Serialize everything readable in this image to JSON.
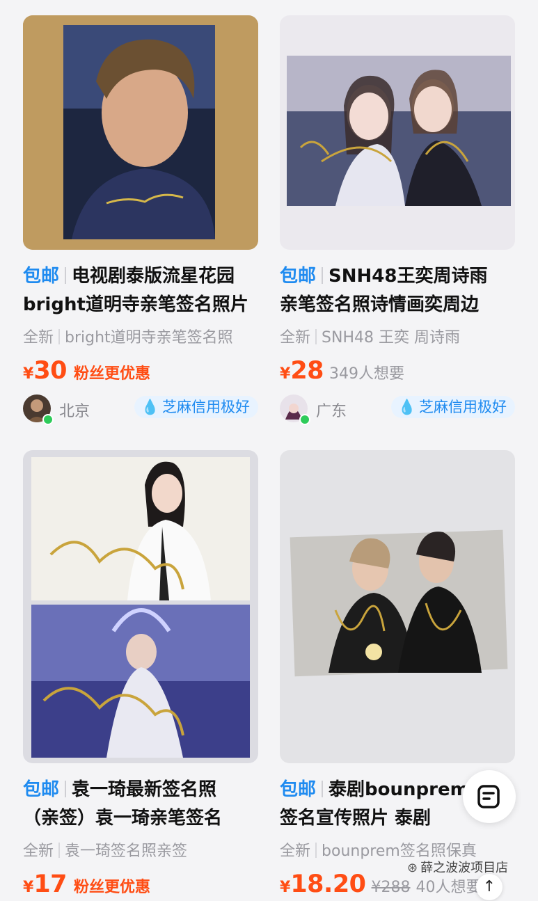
{
  "items": [
    {
      "tag": "包邮",
      "title_line1": "电视剧泰版流星花园",
      "title_line2": "bright道明寺亲笔签名照片",
      "condition": "全新",
      "keywords": "bright道明寺亲笔签名照",
      "currency": "¥",
      "price": "30",
      "promo": "粉丝更优惠",
      "wants": "",
      "original_price": "",
      "city": "北京",
      "credit": "芝麻信用极好"
    },
    {
      "tag": "包邮",
      "title_line1": "SNH48王奕周诗雨",
      "title_line2": "亲笔签名照诗情画奕周边",
      "condition": "全新",
      "keywords": "SNH48 王奕 周诗雨",
      "currency": "¥",
      "price": "28",
      "promo": "",
      "wants": "349人想要",
      "original_price": "",
      "city": "广东",
      "credit": "芝麻信用极好"
    },
    {
      "tag": "包邮",
      "title_line1": "袁一琦最新签名照",
      "title_line2": "（亲签）袁一琦亲笔签名",
      "condition": "全新",
      "keywords": "袁一琦签名照亲签",
      "currency": "¥",
      "price": "17",
      "promo": "粉丝更优惠",
      "wants": "",
      "original_price": "",
      "city": "",
      "credit": ""
    },
    {
      "tag": "包邮",
      "title_line1": "泰剧bounprem亲笔",
      "title_line2": "签名宣传照片 泰剧",
      "condition": "全新",
      "keywords": "bounprem签名照保真",
      "currency": "¥",
      "price": "18.20",
      "promo": "",
      "wants": "40人想要",
      "original_price": "¥288",
      "city": "",
      "credit": ""
    }
  ],
  "watermark": "薛之波波项目店",
  "icons": {
    "fab": "edit-note-icon",
    "scroll_top": "arrow-up-icon",
    "credit": "water-drop-icon",
    "watermark": "wechat-channel-icon"
  },
  "colors": {
    "tag": "#1f8bf0",
    "price": "#ff4d14",
    "credit_bg": "#e8f3ff",
    "online": "#2ecb5a"
  }
}
